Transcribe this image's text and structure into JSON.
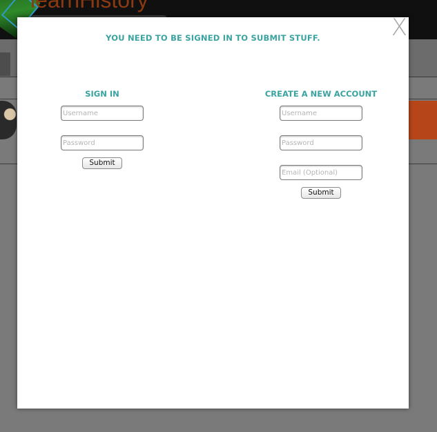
{
  "background": {
    "site_logo_text": "learnHistory"
  },
  "modal": {
    "close_label": "X",
    "notice": "YOU NEED TO BE SIGNED IN TO SUBMIT STUFF.",
    "sign_in": {
      "title": "SIGN IN",
      "username_placeholder": "Username",
      "password_placeholder": "Password",
      "submit_label": "Submit"
    },
    "create_account": {
      "title": "CREATE A NEW ACCOUNT",
      "username_placeholder": "Username",
      "password_placeholder": "Password",
      "email_placeholder": "Email (Optional)",
      "submit_label": "Submit"
    }
  },
  "colors": {
    "accent": "#3aa3a0",
    "overlay": "#7a7a7a",
    "header_bg": "#101010",
    "logo_orange": "#8a3a10",
    "banner_orange": "#b6461a"
  }
}
